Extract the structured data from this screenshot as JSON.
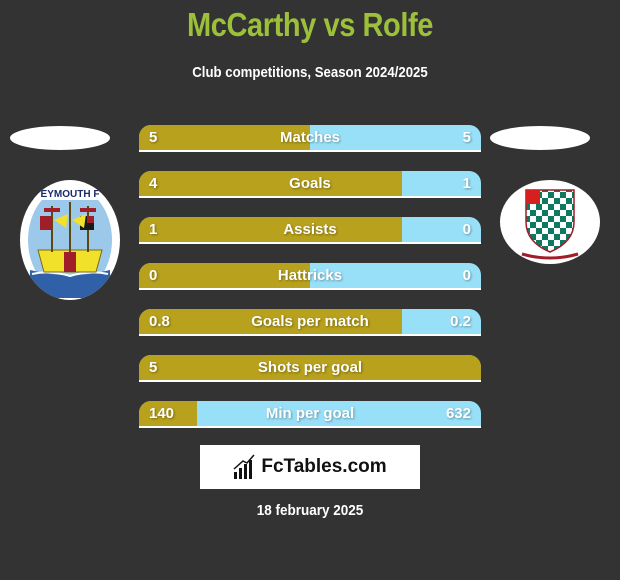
{
  "header": {
    "title": "McCarthy vs Rolfe",
    "subtitle": "Club competitions, Season 2024/2025"
  },
  "players": {
    "left": {
      "name": "McCarthy",
      "club_badge": "weymouth-crest-icon",
      "badge_text": "EYMOUTH F"
    },
    "right": {
      "name": "Rolfe",
      "club_badge": "chesham-united-crest-icon"
    }
  },
  "colors": {
    "title": "#9dc03a",
    "left_bar": "#b8a11c",
    "right_bar": "#98e0f8",
    "background": "#333333"
  },
  "stats": [
    {
      "label": "Matches",
      "left": "5",
      "right": "5",
      "left_share": 0.5
    },
    {
      "label": "Goals",
      "left": "4",
      "right": "1",
      "left_share": 0.77
    },
    {
      "label": "Assists",
      "left": "1",
      "right": "0",
      "left_share": 0.77
    },
    {
      "label": "Hattricks",
      "left": "0",
      "right": "0",
      "left_share": 0.5
    },
    {
      "label": "Goals per match",
      "left": "0.8",
      "right": "0.2",
      "left_share": 0.77
    },
    {
      "label": "Shots per goal",
      "left": "5",
      "right": "",
      "left_share": 1.0
    },
    {
      "label": "Min per goal",
      "left": "140",
      "right": "632",
      "left_share": 0.17
    }
  ],
  "footer": {
    "logo_text": "FcTables.com",
    "logo_icon": "bar-chart-icon",
    "date": "18 february 2025"
  }
}
